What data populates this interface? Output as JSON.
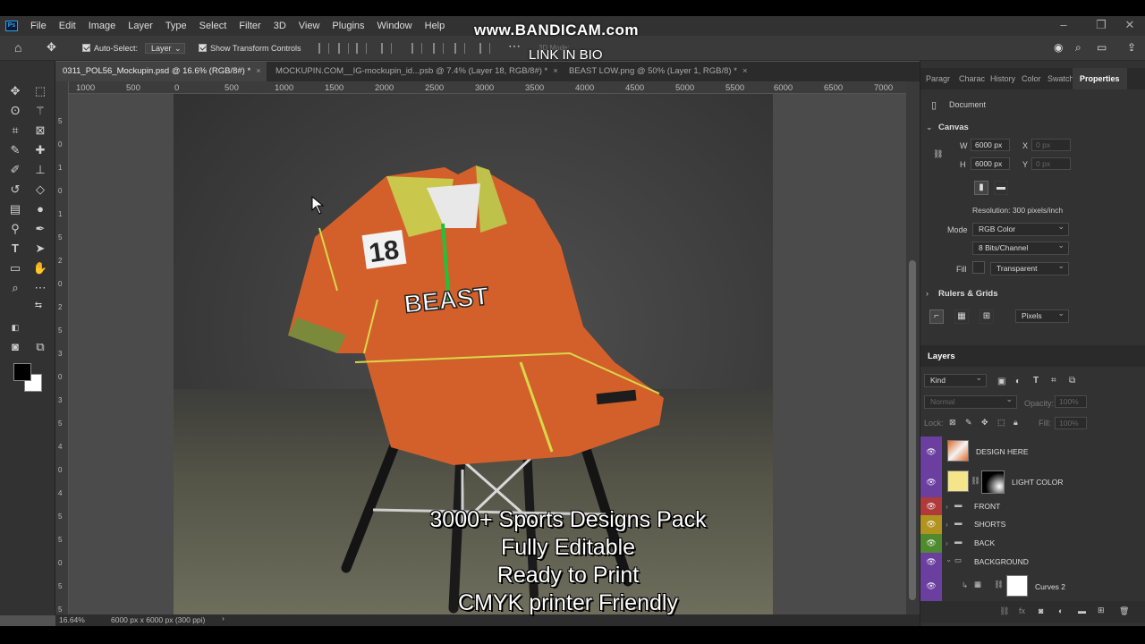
{
  "menubar": {
    "app_icon": "Ps",
    "items": [
      "File",
      "Edit",
      "Image",
      "Layer",
      "Type",
      "Select",
      "Filter",
      "3D",
      "View",
      "Plugins",
      "Window",
      "Help"
    ]
  },
  "watermark": {
    "line1": "www.BANDICAM.com",
    "line2": "LINK IN BIO"
  },
  "options": {
    "auto_select_label": "Auto-Select:",
    "auto_select_value": "Layer",
    "show_transform_label": "Show Transform Controls",
    "mode_3d": "3D Mode:"
  },
  "tabs": [
    {
      "label": "0311_POL56_Mockupin.psd @ 16.6% (RGB/8#) *",
      "active": true
    },
    {
      "label": "MOCKUPIN.COM__IG-mockupin_id...psb @ 7.4% (Layer 18, RGB/8#) *",
      "active": false
    },
    {
      "label": "BEAST LOW.png @ 50% (Layer 1, RGB/8) *",
      "active": false
    }
  ],
  "ruler_h": [
    "1000",
    "500",
    "0",
    "500",
    "1000",
    "1500",
    "2000",
    "2500",
    "3000",
    "3500",
    "4000",
    "4500",
    "5000",
    "5500",
    "6000",
    "6500",
    "7000"
  ],
  "ruler_v": [
    "5",
    "0",
    "1",
    "0",
    "1",
    "5",
    "2",
    "0",
    "2",
    "5",
    "3",
    "0",
    "3",
    "5",
    "4",
    "0",
    "4",
    "5",
    "5",
    "0",
    "5",
    "5"
  ],
  "status": {
    "zoom": "16.64%",
    "doc_info": "6000 px x 6000 px (300 ppi)"
  },
  "properties": {
    "tabs": [
      "Paragr",
      "Charac",
      "History",
      "Color",
      "Swatch",
      "Properties"
    ],
    "document_label": "Document",
    "canvas_title": "Canvas",
    "w_label": "W",
    "w_value": "6000 px",
    "x_label": "X",
    "x_placeholder": "0 px",
    "h_label": "H",
    "h_value": "6000 px",
    "y_label": "Y",
    "y_placeholder": "0 px",
    "resolution": "Resolution: 300 pixels/inch",
    "mode_label": "Mode",
    "mode_value": "RGB Color",
    "bits_value": "8 Bits/Channel",
    "fill_label": "Fill",
    "fill_value": "Transparent",
    "rulers_title": "Rulers & Grids",
    "units_value": "Pixels"
  },
  "layers": {
    "title": "Layers",
    "kind_label": "Kind",
    "blend_value": "Normal",
    "opacity_label": "Opacity:",
    "opacity_value": "100%",
    "lock_label": "Lock:",
    "fill_label": "Fill:",
    "fill_value": "100%",
    "items": [
      {
        "name": "DESIGN HERE",
        "color": "#6a3fa0",
        "type": "image"
      },
      {
        "name": "LIGHT COLOR",
        "color": "#6a3fa0",
        "type": "adjust"
      },
      {
        "name": "FRONT",
        "color": "#b03a3a",
        "type": "group"
      },
      {
        "name": "SHORTS",
        "color": "#b0941e",
        "type": "group"
      },
      {
        "name": "BACK",
        "color": "#4f8a2e",
        "type": "group"
      },
      {
        "name": "BACKGROUND",
        "color": "#6a3fa0",
        "type": "group"
      },
      {
        "name": "Curves 2",
        "color": "#6a3fa0",
        "type": "curves"
      }
    ]
  },
  "overlay": {
    "line1": "3000+ Sports Designs Pack",
    "line2": "Fully Editable",
    "line3": "Ready to Print",
    "line4": "CMYK printer Friendly"
  },
  "shirt": {
    "number": "18",
    "logo": "BEAST"
  }
}
